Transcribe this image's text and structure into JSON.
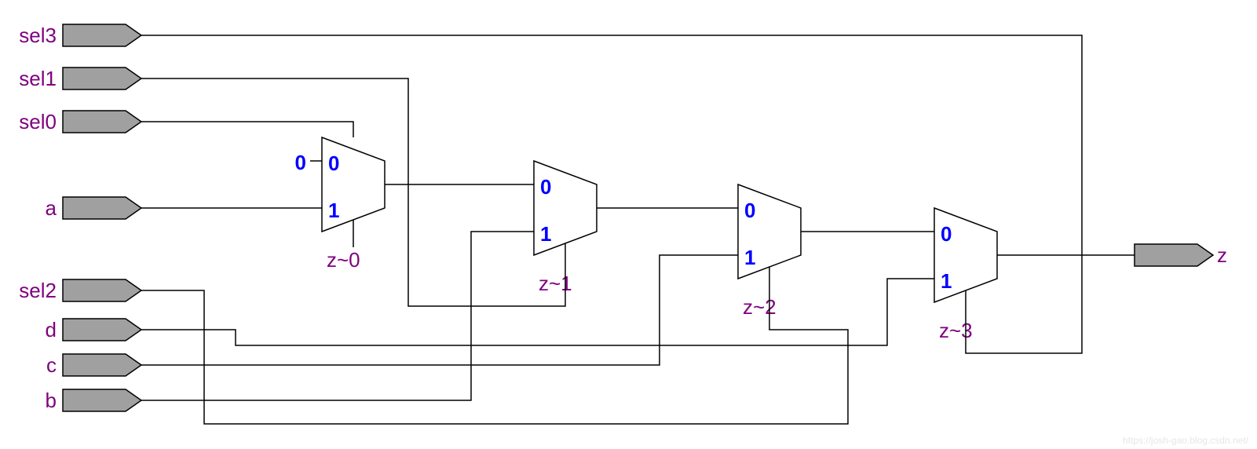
{
  "inputs": {
    "sel3": "sel3",
    "sel1": "sel1",
    "sel0": "sel0",
    "a": "a",
    "sel2": "sel2",
    "d": "d",
    "c": "c",
    "b": "b"
  },
  "output": {
    "z": "z"
  },
  "mux": {
    "const0": "0",
    "in0": "0",
    "in1": "1",
    "z0_name": "z~0",
    "z1_name": "z~1",
    "z2_name": "z~2",
    "z3_name": "z~3"
  },
  "watermark": "https://josh-gao.blog.csdn.net/"
}
